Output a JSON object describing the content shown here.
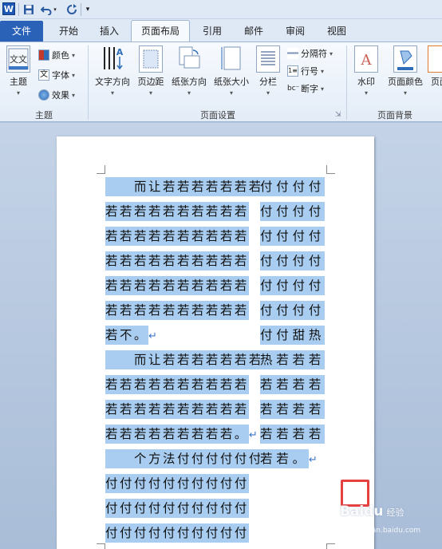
{
  "quick_access": {
    "app_icon": "W",
    "save": "save-icon",
    "undo": "undo-icon",
    "redo": "redo-icon",
    "customize": "customize-icon"
  },
  "tabs": {
    "file": "文件",
    "home": "开始",
    "insert": "插入",
    "page_layout": "页面布局",
    "references": "引用",
    "mailings": "邮件",
    "review": "审阅",
    "view": "视图"
  },
  "ribbon": {
    "themes_group": {
      "label": "主题",
      "themes": "主题",
      "colors": "颜色",
      "fonts": "字体",
      "effects": "效果"
    },
    "page_setup_group": {
      "label": "页面设置",
      "text_direction": "文字方向",
      "margins": "页边距",
      "orientation": "纸张方向",
      "size": "纸张大小",
      "columns": "分栏",
      "breaks": "分隔符",
      "line_numbers": "行号",
      "hyphenation": "断字"
    },
    "page_background_group": {
      "label": "页面背景",
      "watermark": "水印",
      "page_color": "页面颜色",
      "page_borders": "页面"
    }
  },
  "document": {
    "left_column": [
      {
        "text": "　　而让若若若若若若若",
        "mark": ""
      },
      {
        "text": "若若若若若若若若若若",
        "mark": ""
      },
      {
        "text": "若若若若若若若若若若",
        "mark": ""
      },
      {
        "text": "若若若若若若若若若若",
        "mark": ""
      },
      {
        "text": "若若若若若若若若若若",
        "mark": ""
      },
      {
        "text": "若若若若若若若若若若",
        "mark": ""
      },
      {
        "text": "若不。",
        "mark": "↵"
      },
      {
        "text": "　　而让若若若若若若若",
        "mark": ""
      },
      {
        "text": "若若若若若若若若若若",
        "mark": ""
      },
      {
        "text": "若若若若若若若若若若",
        "mark": ""
      },
      {
        "text": "若若若若若若若若若。",
        "mark": "↵"
      },
      {
        "text": "　　个方法付付付付付付",
        "mark": ""
      },
      {
        "text": "付付付付付付付付付付",
        "mark": ""
      },
      {
        "text": "付付付付付付付付付付",
        "mark": ""
      },
      {
        "text": "付付付付付付付付付付",
        "mark": ""
      }
    ],
    "right_column": [
      {
        "text": "付付付付",
        "mark": ""
      },
      {
        "text": "付付付付",
        "mark": ""
      },
      {
        "text": "付付付付",
        "mark": ""
      },
      {
        "text": "付付付付",
        "mark": ""
      },
      {
        "text": "付付付付",
        "mark": ""
      },
      {
        "text": "付付付付",
        "mark": ""
      },
      {
        "text": "付付甜热",
        "mark": ""
      },
      {
        "text": "热若若若",
        "mark": ""
      },
      {
        "text": "若若若若",
        "mark": ""
      },
      {
        "text": "若若若若",
        "mark": ""
      },
      {
        "text": "若若若若",
        "mark": ""
      },
      {
        "text": "若若。",
        "mark": "↵"
      }
    ]
  },
  "watermark": {
    "brand": "Baidu",
    "suffix": "经验",
    "url": "jingyan.baidu.com"
  },
  "colors": {
    "selection": "#a8cdf1",
    "file_tab": "#2a62b7",
    "highlight_box": "#e64141"
  }
}
